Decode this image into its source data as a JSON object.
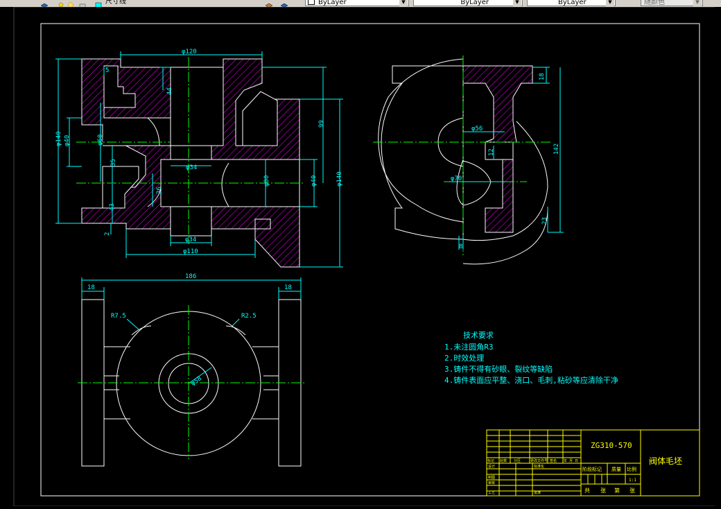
{
  "toolbar": {
    "layer_name": "尺寸线",
    "color_value": "ByLayer",
    "linetype_value": "ByLayer",
    "lineweight_value": "ByLayer",
    "plotstyle_value": "随颜色"
  },
  "dims": {
    "d120": "φ120",
    "d5": "5",
    "d44": "44",
    "d140_left": "φ140",
    "d40_left": "φ40",
    "d60": "φ60",
    "d35": "35",
    "d43": "43",
    "d2": "2",
    "d34_top": "φ34",
    "d26": "26",
    "d80": "φ80",
    "d40_right": "φ40",
    "d140_right": "φ140",
    "d99": "99",
    "d34_bottom": "φ34",
    "d110": "φ110",
    "d56": "φ56",
    "d70": "φ70",
    "d12": "12",
    "d18_side": "18",
    "d142": "142",
    "d23": "23",
    "d8": "8",
    "d186": "186",
    "d18_a": "18",
    "d18_b": "18",
    "r75": "R7.5",
    "r25": "R2.5",
    "d58": "φ58"
  },
  "notes": {
    "title": "技术要求",
    "items": [
      "1.未注圆角R3",
      "2.时效处理",
      "3.铸件不得有砂眼、裂纹等缺陷",
      "4.铸件表面应平整、浇口、毛刺,粘砂等应清除干净"
    ]
  },
  "titleblock": {
    "material": "ZG310-570",
    "part_name": "阀体毛坯",
    "stage_mark": "阶段标记",
    "weight": "质量",
    "scale_label": "比例",
    "scale_value": "1:1",
    "sheets": [
      "共",
      "张",
      "第",
      "张"
    ],
    "rev_cols": [
      "标记",
      "处数",
      "分区",
      "更改文件号",
      "签名",
      "年 月 日"
    ],
    "roles_left": [
      "设计",
      "审核",
      "工艺"
    ],
    "roles_extra": "制图",
    "std_label": "标准化",
    "approve_label": "批准"
  },
  "colors": {
    "background": "#000000",
    "outline": "#ffffff",
    "dimension": "#00ffff",
    "hatch": "#ff00ff",
    "centerline": "#00ff00",
    "border": "#ffffff",
    "titleblock": "#ffff00"
  }
}
